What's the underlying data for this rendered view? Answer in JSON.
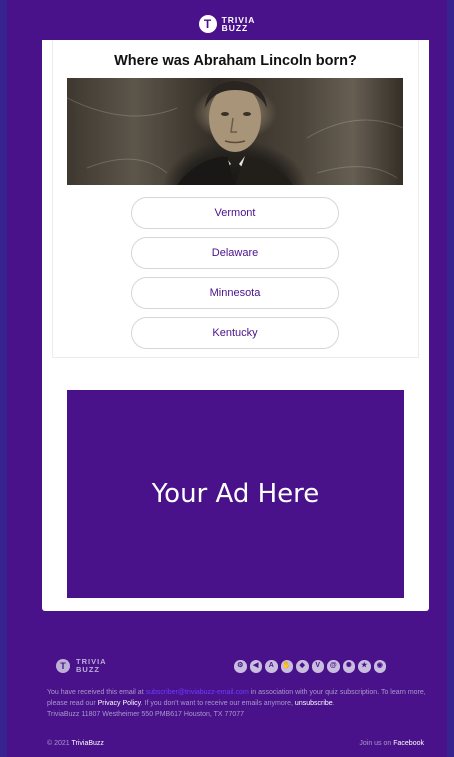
{
  "brand": {
    "logo_letter": "T",
    "logo_line1": "TRIVIA",
    "logo_line2": "BUZZ"
  },
  "quiz": {
    "question": "Where was Abraham Lincoln born?",
    "answers": [
      "Vermont",
      "Delaware",
      "Minnesota",
      "Kentucky"
    ]
  },
  "ad": {
    "text": "Your Ad Here"
  },
  "footer": {
    "social_icons": [
      "gear-icon",
      "chat-icon",
      "a-icon",
      "hand-icon",
      "shield-icon",
      "v-icon",
      "swirl-icon",
      "starburst-icon",
      "star-icon",
      "eye-icon"
    ],
    "notice_prefix": "You have received this email at",
    "notice_email": "subscriber@triviabuzz-email.com",
    "notice_suffix": "in association with your quiz subscription. To learn more, please read our",
    "privacy_label": "Privacy Policy",
    "notice_mid": ". If you don't want to receive our emails anymore,",
    "unsubscribe_label": "unsubscribe",
    "address": "TriviaBuzz 11807 Westheimer 550 PMB617 Houston, TX 77077",
    "copyright_prefix": "© 2021",
    "copyright_brand": "TriviaBuzz",
    "join_prefix": "Join us on",
    "join_link": "Facebook"
  },
  "colors": {
    "brand_purple": "#4a128a",
    "outer": "#3a1d8f",
    "email_link": "#6b3cff"
  }
}
